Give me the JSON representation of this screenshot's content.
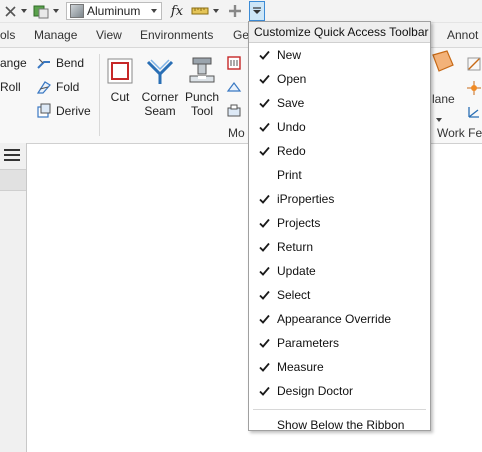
{
  "quick_access": {
    "material_value": "Aluminum",
    "fx_symbol": "fx"
  },
  "tabs": [
    {
      "label": "ols"
    },
    {
      "label": "Manage"
    },
    {
      "label": "View"
    },
    {
      "label": "Environments"
    },
    {
      "label": "Ge"
    },
    {
      "label": "Annot"
    }
  ],
  "ribbon": {
    "left_tools": [
      {
        "label": "ange"
      },
      {
        "label": "Roll"
      }
    ],
    "tools": [
      {
        "label": "Bend"
      },
      {
        "label": "Fold"
      },
      {
        "label": "Derive"
      }
    ],
    "cut_label": "Cut",
    "corner_seam_line1": "Corner",
    "corner_seam_line2": "Seam",
    "punch_tool_line1": "Punch",
    "punch_tool_line2": "Tool",
    "modify_panel_label": "Mo",
    "plane_label": "lane",
    "work_features_label": "Work Fea"
  },
  "menu": {
    "title": "Customize Quick Access Toolbar",
    "items": [
      {
        "label": "New",
        "checked": true
      },
      {
        "label": "Open",
        "checked": true
      },
      {
        "label": "Save",
        "checked": true
      },
      {
        "label": "Undo",
        "checked": true
      },
      {
        "label": "Redo",
        "checked": true
      },
      {
        "label": "Print",
        "checked": false
      },
      {
        "label": "iProperties",
        "checked": true
      },
      {
        "label": "Projects",
        "checked": true
      },
      {
        "label": "Return",
        "checked": true
      },
      {
        "label": "Update",
        "checked": true
      },
      {
        "label": "Select",
        "checked": true
      },
      {
        "label": "Appearance Override",
        "checked": true
      },
      {
        "label": "Parameters",
        "checked": true
      },
      {
        "label": "Measure",
        "checked": true
      },
      {
        "label": "Design Doctor",
        "checked": true
      }
    ],
    "show_below_label": "Show Below the Ribbon"
  }
}
